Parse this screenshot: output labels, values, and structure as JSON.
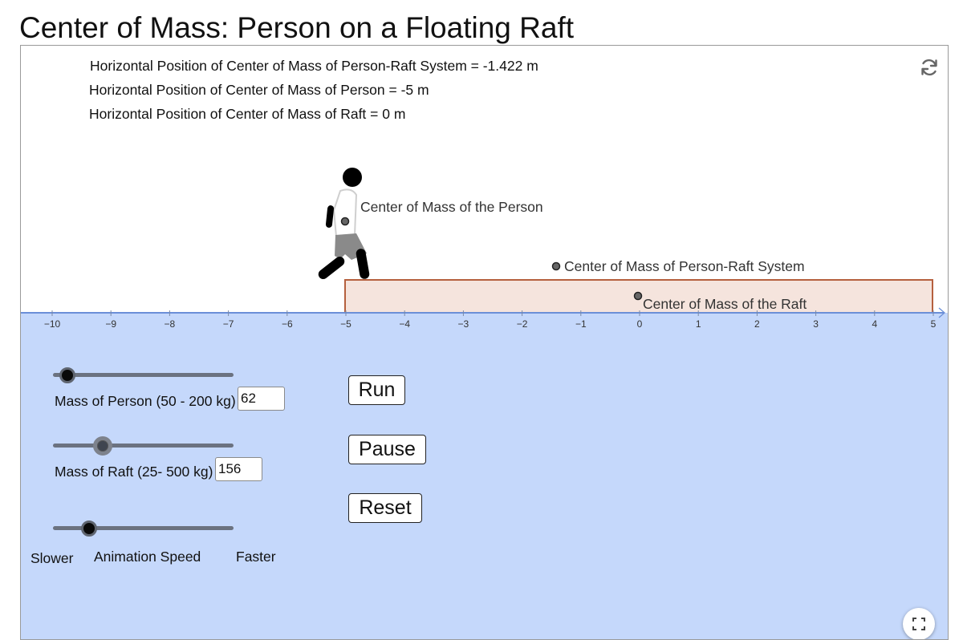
{
  "page": {
    "title": "Center of Mass: Person on a Floating Raft"
  },
  "info": {
    "system_com": "Horizontal Position of Center of Mass of Person-Raft System = -1.422 m",
    "person_com": "Horizontal Position of Center of Mass of Person = -5 m",
    "raft_com": "Horizontal Position of Center of Mass of Raft = 0 m"
  },
  "scene": {
    "labels": {
      "person": "Center of Mass of the Person",
      "system": "Center of Mass of Person-Raft System",
      "raft": "Center of Mass of the Raft"
    },
    "axis_ticks": [
      "−10",
      "−9",
      "−8",
      "−7",
      "−6",
      "−5",
      "−4",
      "−3",
      "−2",
      "−1",
      "0",
      "1",
      "2",
      "3",
      "4",
      "5"
    ],
    "person_position_m": -5,
    "system_position_m": -1.422,
    "raft_position_m": 0,
    "raft_extent_m": [
      -5,
      5
    ],
    "colors": {
      "water": "#c5d8fb",
      "raft_fill": "#f5e4dd",
      "raft_stroke": "#b5603e",
      "axis": "#6b8fd8"
    }
  },
  "controls": {
    "person_mass": {
      "label": "Mass of Person (50 - 200 kg)",
      "value": "62",
      "min": 50,
      "max": 200
    },
    "raft_mass": {
      "label": "Mass of Raft (25- 500 kg)",
      "value": "156",
      "min": 25,
      "max": 500
    },
    "speed": {
      "label": "Animation Speed",
      "slower": "Slower",
      "faster": "Faster",
      "level": 0.2
    },
    "run": "Run",
    "pause": "Pause",
    "reset": "Reset"
  },
  "icons": {
    "refresh": "refresh-icon",
    "fullscreen": "fullscreen-icon"
  }
}
